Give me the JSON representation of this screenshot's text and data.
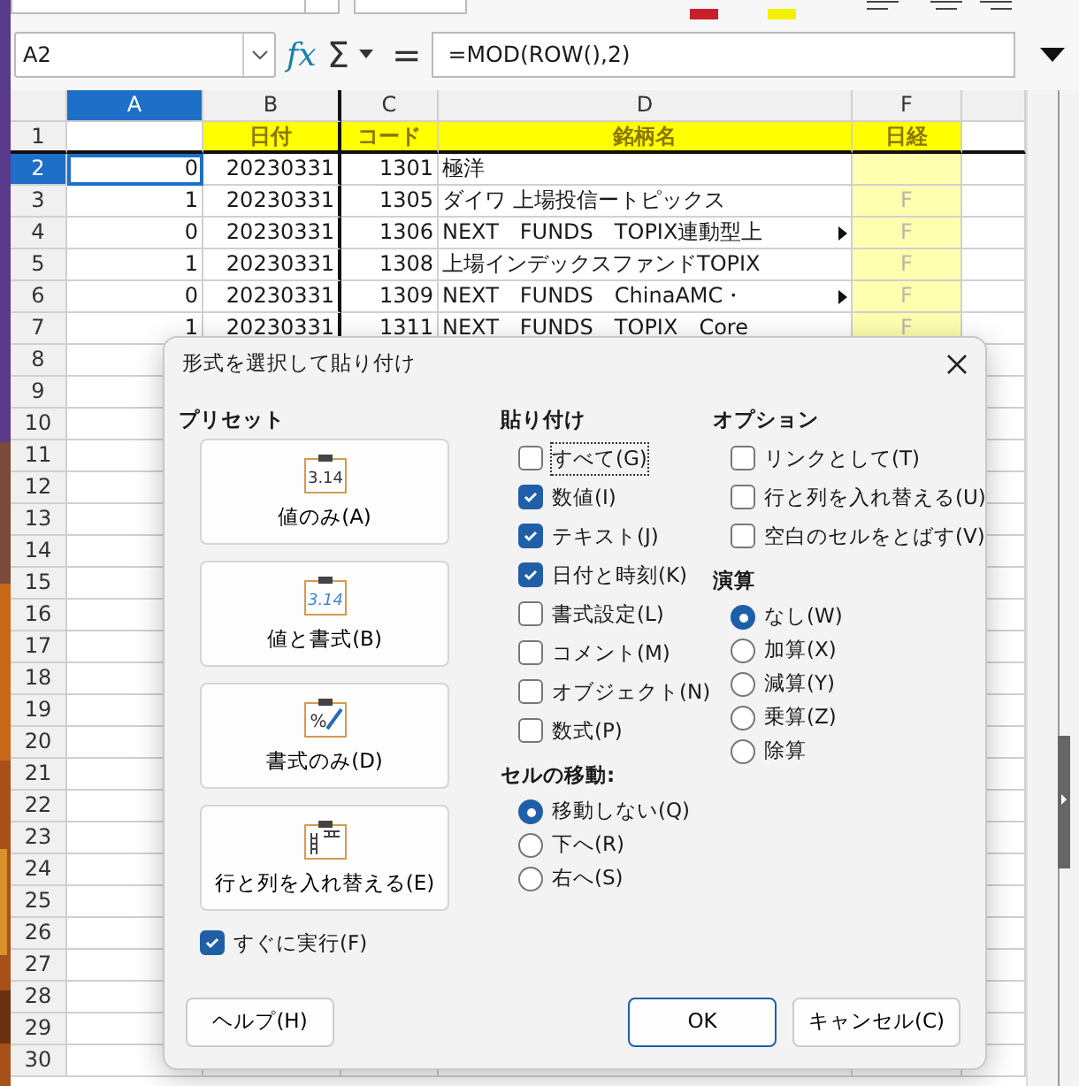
{
  "formula_bar": {
    "cell_reference": "A2",
    "function_symbol": "fx",
    "sum_symbol": "Σ",
    "equals_symbol": "=",
    "formula": "=MOD(ROW(),2)"
  },
  "sheet": {
    "columns": [
      {
        "label": "A",
        "selected": true
      },
      {
        "label": "B",
        "selected": false
      },
      {
        "label": "C",
        "selected": false
      },
      {
        "label": "D",
        "selected": false
      },
      {
        "label": "F",
        "selected": false
      }
    ],
    "header_row": {
      "number": "1",
      "cells": [
        "日付",
        "コード",
        "銘柄名",
        "日経"
      ]
    },
    "rows": [
      {
        "number": "2",
        "selected": true,
        "a": "0",
        "b": "20230331",
        "c": "1301",
        "d": "極洋",
        "truncated": false
      },
      {
        "number": "3",
        "selected": false,
        "a": "1",
        "b": "20230331",
        "c": "1305",
        "d": "ダイワ 上場投信ートピックス",
        "truncated": false,
        "f": "F"
      },
      {
        "number": "4",
        "selected": false,
        "a": "0",
        "b": "20230331",
        "c": "1306",
        "d": "NEXT　FUNDS　TOPIX連動型上",
        "truncated": true,
        "f": "F"
      },
      {
        "number": "5",
        "selected": false,
        "a": "1",
        "b": "20230331",
        "c": "1308",
        "d": "上場インデックスファンドTOPIX",
        "truncated": false,
        "f": "F"
      },
      {
        "number": "6",
        "selected": false,
        "a": "0",
        "b": "20230331",
        "c": "1309",
        "d": "NEXT　FUNDS　ChinaAMC・",
        "truncated": true,
        "f": "F"
      },
      {
        "number": "7",
        "selected": false,
        "a": "1",
        "b": "20230331",
        "c": "1311",
        "d": "NEXT　FUNDS　TOPIX　Core",
        "truncated": false,
        "f": "F"
      }
    ],
    "blank_rows": [
      "8",
      "9",
      "10",
      "11",
      "12",
      "13",
      "14",
      "15",
      "16",
      "17",
      "18",
      "19",
      "20",
      "21",
      "22",
      "23",
      "24",
      "25",
      "26",
      "27",
      "28",
      "29",
      "30"
    ]
  },
  "dialog": {
    "title": "形式を選択して貼り付け",
    "presets": {
      "heading": "プリセット",
      "buttons": [
        {
          "label": "値のみ(A)",
          "kind": "values",
          "icon_text": "3.14"
        },
        {
          "label": "値と書式(B)",
          "kind": "values_formats",
          "icon_text": "3.14"
        },
        {
          "label": "書式のみ(D)",
          "kind": "formats",
          "icon_text": "%"
        },
        {
          "label": "行と列を入れ替える(E)",
          "kind": "transpose"
        }
      ]
    },
    "run_immediately": {
      "label": "すぐに実行(F)",
      "checked": true
    },
    "paste": {
      "heading": "貼り付け",
      "options": [
        {
          "label": "すべて(G)",
          "checked": false,
          "focused": true
        },
        {
          "label": "数値(I)",
          "checked": true,
          "focused": false
        },
        {
          "label": "テキスト(J)",
          "checked": true,
          "focused": false
        },
        {
          "label": "日付と時刻(K)",
          "checked": true,
          "focused": false
        },
        {
          "label": "書式設定(L)",
          "checked": false,
          "focused": false
        },
        {
          "label": "コメント(M)",
          "checked": false,
          "focused": false
        },
        {
          "label": "オブジェクト(N)",
          "checked": false,
          "focused": false
        },
        {
          "label": "数式(P)",
          "checked": false,
          "focused": false
        }
      ]
    },
    "cell_shift": {
      "heading": "セルの移動:",
      "options": [
        {
          "label": "移動しない(Q)",
          "selected": true
        },
        {
          "label": "下へ(R)",
          "selected": false
        },
        {
          "label": "右へ(S)",
          "selected": false
        }
      ]
    },
    "options": {
      "heading": "オプション",
      "options": [
        {
          "label": "リンクとして(T)",
          "checked": false
        },
        {
          "label": "行と列を入れ替える(U)",
          "checked": false
        },
        {
          "label": "空白のセルをとばす(V)",
          "checked": false
        }
      ]
    },
    "operation": {
      "heading": "演算",
      "options": [
        {
          "label": "なし(W)",
          "selected": true
        },
        {
          "label": "加算(X)",
          "selected": false
        },
        {
          "label": "減算(Y)",
          "selected": false
        },
        {
          "label": "乗算(Z)",
          "selected": false
        },
        {
          "label": "除算",
          "selected": false
        }
      ]
    },
    "buttons": [
      {
        "label": "ヘルプ(H)",
        "kind": "help"
      },
      {
        "label": "OK",
        "kind": "default"
      },
      {
        "label": "キャンセル(C)",
        "kind": "normal"
      }
    ]
  }
}
